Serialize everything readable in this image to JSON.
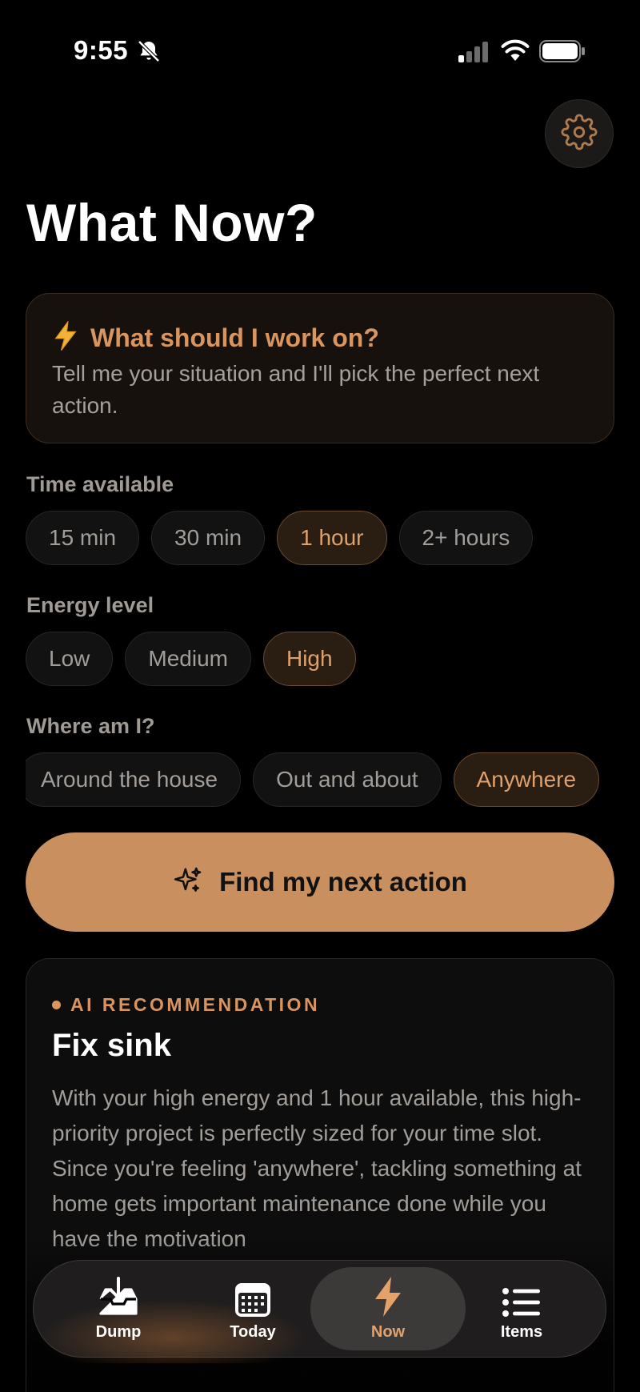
{
  "status_bar": {
    "time": "9:55"
  },
  "header": {
    "title": "What Now?"
  },
  "intro": {
    "title": "What should I work on?",
    "text": "Tell me your situation and I'll pick the perfect next action."
  },
  "time_section": {
    "label": "Time available",
    "options": [
      "15 min",
      "30 min",
      "1 hour",
      "2+ hours"
    ],
    "selected": "1 hour"
  },
  "energy_section": {
    "label": "Energy level",
    "options": [
      "Low",
      "Medium",
      "High"
    ],
    "selected": "High"
  },
  "location_section": {
    "label": "Where am I?",
    "options": [
      "Around the house",
      "Out and about",
      "Anywhere"
    ],
    "selected": "Anywhere"
  },
  "find_button": {
    "label": "Find my next action"
  },
  "recommendation": {
    "eyebrow": "AI RECOMMENDATION",
    "title": "Fix sink",
    "body": "With your high energy and 1 hour available, this high-priority project is perfectly sized for your time slot. Since you're feeling 'anywhere', tackling something at home gets important maintenance done while you have the motivation"
  },
  "tab_bar": {
    "tabs": [
      {
        "label": "Dump",
        "icon": "inbox-download-icon"
      },
      {
        "label": "Today",
        "icon": "calendar-icon"
      },
      {
        "label": "Now",
        "icon": "lightning-icon"
      },
      {
        "label": "Items",
        "icon": "list-icon"
      }
    ],
    "active": "Now"
  },
  "colors": {
    "accent": "#d9955d",
    "button": "#c98f5e",
    "background": "#000000"
  }
}
